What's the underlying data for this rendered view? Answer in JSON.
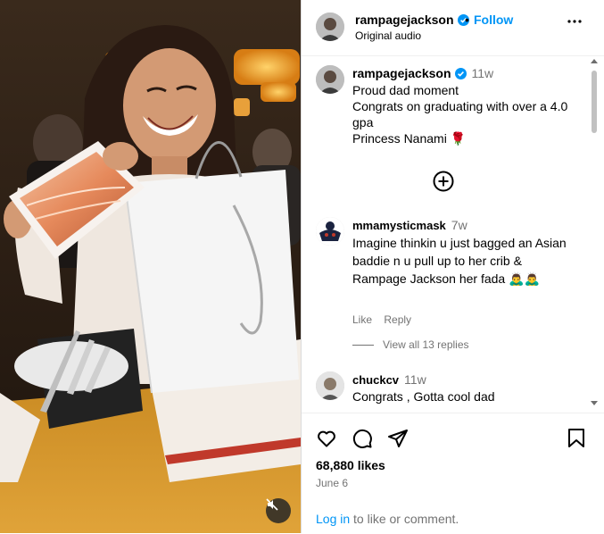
{
  "header": {
    "username": "rampagejackson",
    "dot": "•",
    "follow_label": "Follow",
    "subtitle": "Original audio"
  },
  "caption": {
    "username": "rampagejackson",
    "time": "11w",
    "lines": [
      "Proud dad moment",
      "Congrats on graduating with over a 4.0 gpa",
      "Princess Nanami 🌹"
    ]
  },
  "comments": [
    {
      "username": "mmamysticmask",
      "time": "7w",
      "text": "Imagine thinkin u just bagged an Asian baddie n u pull up to her crib & Rampage Jackson her fada 🙇‍♂️🙇‍♂️",
      "like_label": "Like",
      "reply_label": "Reply",
      "view_replies": "View all 13 replies"
    },
    {
      "username": "chuckcv",
      "time": "11w",
      "text": "Congrats , Gotta cool dad"
    }
  ],
  "footer": {
    "likes": "68,880 likes",
    "date": "June 6",
    "login_link": "Log in",
    "login_rest": " to like or comment."
  },
  "icons": {
    "like": "heart-icon",
    "comment": "comment-bubble-icon",
    "share": "paper-plane-icon",
    "save": "bookmark-icon",
    "add_comment": "plus-circle-icon",
    "more": "more-options-icon",
    "mute": "muted-speaker-icon"
  },
  "colors": {
    "link_blue": "#0095f6",
    "muted_text": "#737373",
    "verified_blue": "#0095f6"
  }
}
